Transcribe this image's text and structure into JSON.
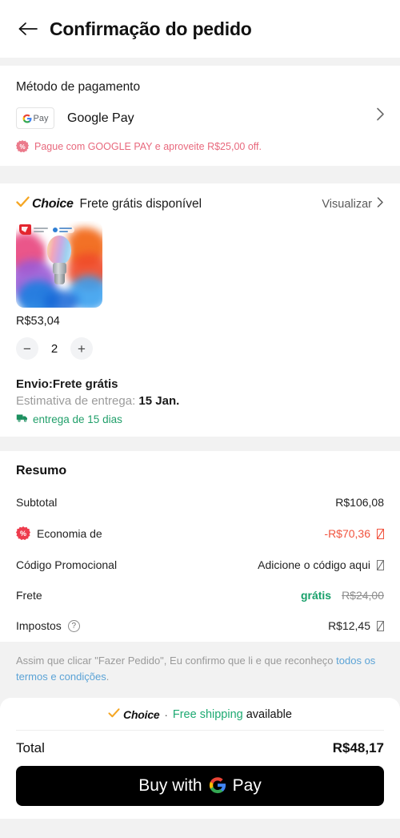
{
  "header": {
    "title": "Confirmação do pedido",
    "back_icon": "arrow-left-icon"
  },
  "payment": {
    "section_title": "Método de pagamento",
    "method_label": "Google Pay",
    "badge_text": "Pay",
    "promo_text": "Pague com GOOGLE PAY e aproveite R$25,00 off.",
    "promo_icon": "percent-badge-icon",
    "chevron_icon": "chevron-right-icon"
  },
  "choice": {
    "logo_word": "Choice",
    "check_icon": "check-icon",
    "subtitle": "Frete grátis disponível",
    "view_label": "Visualizar",
    "view_chevron": "chevron-right-icon",
    "product": {
      "image_name": "smart-bulb-product-image",
      "price": "R$53,04",
      "quantity": "2",
      "minus_label": "−",
      "plus_label": "+"
    },
    "shipping": {
      "title": "Envio:Frete grátis",
      "estimate_label": "Estimativa de entrega:",
      "estimate_date": "15 Jan.",
      "days_text": "entrega de 15 dias",
      "truck_icon": "truck-icon"
    }
  },
  "summary": {
    "title": "Resumo",
    "rows": [
      {
        "label": "Subtotal",
        "value": "R$106,08",
        "icon": null,
        "trailing": null,
        "value_style": "normal"
      },
      {
        "label": "Economia de",
        "value": "-R$70,36",
        "icon": "percent-badge-icon",
        "trailing": "missing-glyph",
        "value_style": "discount"
      },
      {
        "label": "Código Promocional",
        "value": "Adicione o código aqui",
        "icon": null,
        "trailing": "missing-glyph",
        "value_style": "normal"
      },
      {
        "label": "Frete",
        "value": "grátis",
        "value_strikethrough": "R$24,00",
        "icon": null,
        "trailing": null,
        "value_style": "free"
      },
      {
        "label": "Impostos",
        "value": "R$12,45",
        "icon": "question-mark-icon",
        "trailing": "missing-glyph",
        "value_style": "normal"
      }
    ]
  },
  "terms": {
    "text_before": "Assim que clicar \"Fazer Pedido\", Eu confirmo que li e que reconheço ",
    "link_text": "todos os termos e condições",
    "text_after": "."
  },
  "footer": {
    "banner": {
      "check_icon": "check-icon",
      "logo_word": "Choice",
      "separator": "·",
      "green_text": "Free shipping",
      "black_text": "available"
    },
    "total_label": "Total",
    "total_value": "R$48,17",
    "pay_button": {
      "prefix": "Buy with",
      "google_icon": "google-g-icon",
      "pay_word": "Pay"
    }
  },
  "colors": {
    "accent_red": "#ee3c4d",
    "promo_pink": "#e8697d",
    "green": "#18a06a",
    "link_blue": "#5ba3d6",
    "choice_amber": "#f5a623",
    "discount_orange": "#f1543f",
    "page_bg": "#f2f2f2",
    "button_black": "#000000"
  }
}
